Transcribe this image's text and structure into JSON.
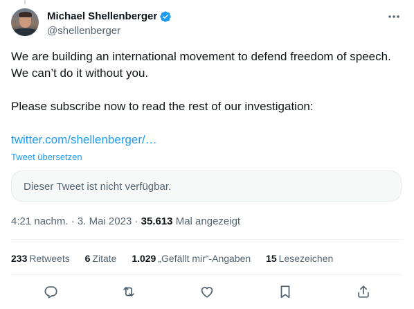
{
  "author": {
    "display_name": "Michael Shellenberger",
    "handle": "@shellenberger",
    "verified": true,
    "verified_color": "#1d9bf0"
  },
  "tweet": {
    "line1": "We are building an international movement to defend freedom of speech.",
    "line2": "We can’t do it without you.",
    "line3": "Please subscribe now to read the rest of our investigation:",
    "link_text": "twitter.com/shellenberger/…",
    "translate_label": "Tweet übersetzen",
    "quote_unavailable": "Dieser Tweet ist nicht verfügbar."
  },
  "meta": {
    "time": "4:21 nachm.",
    "sep1": " · ",
    "date": "3. Mai 2023",
    "sep2": " · ",
    "views": "35.613",
    "views_label": " Mal angezeigt"
  },
  "stats": [
    {
      "count": "233",
      "label": "Retweets"
    },
    {
      "count": "6",
      "label": "Zitate"
    },
    {
      "count": "1.029",
      "label": "„Gefällt mir“-Angaben"
    },
    {
      "count": "15",
      "label": "Lesezeichen"
    }
  ],
  "actions": [
    "reply-icon",
    "retweet-icon",
    "like-icon",
    "bookmark-icon",
    "share-icon"
  ],
  "colors": {
    "link": "#1d9bf0",
    "text": "#0f1419",
    "secondary": "#536471"
  }
}
